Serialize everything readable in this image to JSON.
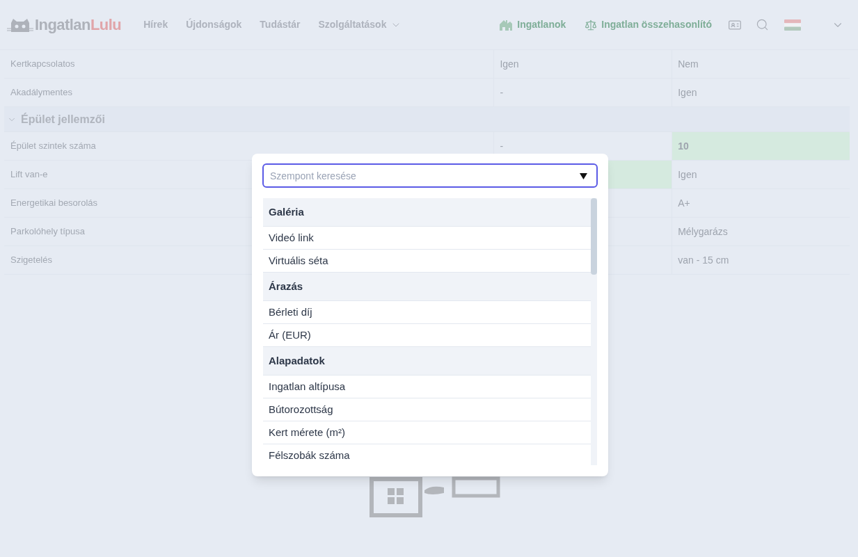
{
  "header": {
    "logo": {
      "first": "Ingatlan",
      "second": "Lulu"
    },
    "nav": [
      {
        "label": "Hírek",
        "dropdown": false
      },
      {
        "label": "Újdonságok",
        "dropdown": false
      },
      {
        "label": "Tudástár",
        "dropdown": false
      },
      {
        "label": "Szolgáltatások",
        "dropdown": true
      }
    ],
    "actions": [
      {
        "kind": "house",
        "label": "Ingatlanok"
      },
      {
        "kind": "scale",
        "label": "Ingatlan összehasonlító"
      }
    ]
  },
  "table": {
    "rows": [
      {
        "kind": "row",
        "label": "Kertkapcsolatos",
        "cells": [
          {
            "text": "Igen",
            "highlight": false
          },
          {
            "text": "Nem",
            "highlight": false
          }
        ]
      },
      {
        "kind": "row",
        "label": "Akadálymentes",
        "cells": [
          {
            "text": "-",
            "highlight": false
          },
          {
            "text": "Igen",
            "highlight": false
          }
        ]
      },
      {
        "kind": "section",
        "label": "Épület jellemzői",
        "expanded": true
      },
      {
        "kind": "row",
        "label": "Épület szintek száma",
        "cells": [
          {
            "text": "-",
            "highlight": false
          },
          {
            "text": "10",
            "highlight": true
          }
        ]
      },
      {
        "kind": "row",
        "label": "Lift van-e",
        "cells": [
          {
            "highlight": true
          },
          {
            "text": "Igen",
            "highlight": false
          }
        ]
      },
      {
        "kind": "row",
        "label": "Energetikai besorolás",
        "cells": [
          {
            "text": "A+",
            "highlight": false
          }
        ]
      },
      {
        "kind": "row",
        "label": "Parkolóhely típusa",
        "cells": [
          {
            "text": "Mélygarázs",
            "highlight": false
          }
        ]
      },
      {
        "kind": "row",
        "label": "Szigetelés",
        "cells": [
          {
            "text": "van - 15 cm",
            "highlight": false
          }
        ]
      }
    ]
  },
  "picker": {
    "search": {
      "placeholder": "Szempont keresése"
    },
    "options": [
      {
        "kind": "group",
        "label": "Galéria"
      },
      {
        "kind": "option",
        "label": "Videó link"
      },
      {
        "kind": "option",
        "label": "Virtuális séta"
      },
      {
        "kind": "group",
        "label": "Árazás"
      },
      {
        "kind": "option",
        "label": "Bérleti díj"
      },
      {
        "kind": "option",
        "label": "Ár (EUR)"
      },
      {
        "kind": "group",
        "label": "Alapadatok"
      },
      {
        "kind": "option",
        "label": "Ingatlan altípusa"
      },
      {
        "kind": "option",
        "label": "Bútorozottság"
      },
      {
        "kind": "option",
        "label": "Kert mérete (m²)"
      },
      {
        "kind": "option",
        "label": "Félszobák száma"
      }
    ]
  }
}
